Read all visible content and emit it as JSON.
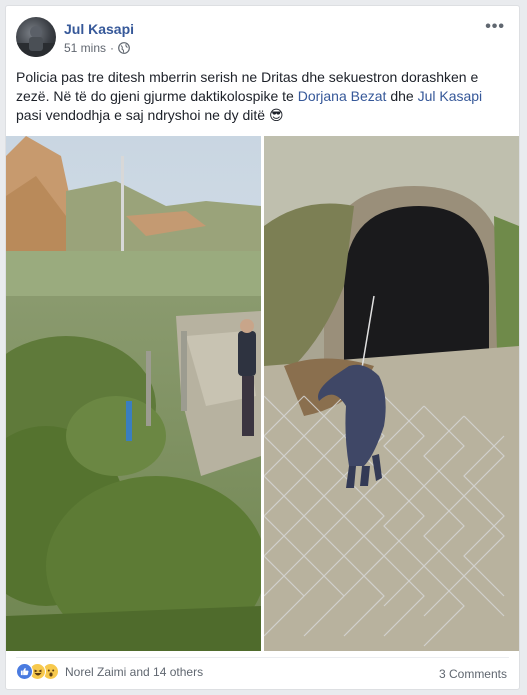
{
  "post": {
    "author": "Jul Kasapi",
    "time": "51 mins",
    "privacy_icon": "globe-icon",
    "more_icon": "more-options-icon",
    "text_part1": "Policia pas tre ditesh mberrin serish ne Dritas dhe sekuestron dorashken e zezë. Në të do gjeni gjurme daktikolospike te ",
    "mention1": "Dorjana Bezat",
    "text_part2": " dhe ",
    "mention2": "Jul Kasapi",
    "text_part3": " pasi vendodhja e saj ndryshoi ne dy ditë ",
    "emoji": "😎",
    "photos": [
      {
        "icon": "photo-landscape"
      },
      {
        "icon": "photo-tunnel-glove"
      }
    ]
  },
  "footer": {
    "reaction_icons": [
      "like-icon",
      "haha-icon",
      "wow-icon"
    ],
    "reaction_names": "Norel Zaimi and 14 others",
    "comments": "3 Comments"
  },
  "colors": {
    "link": "#365899",
    "text": "#1d2129",
    "meta": "#616770",
    "background": "#e9ebee"
  }
}
